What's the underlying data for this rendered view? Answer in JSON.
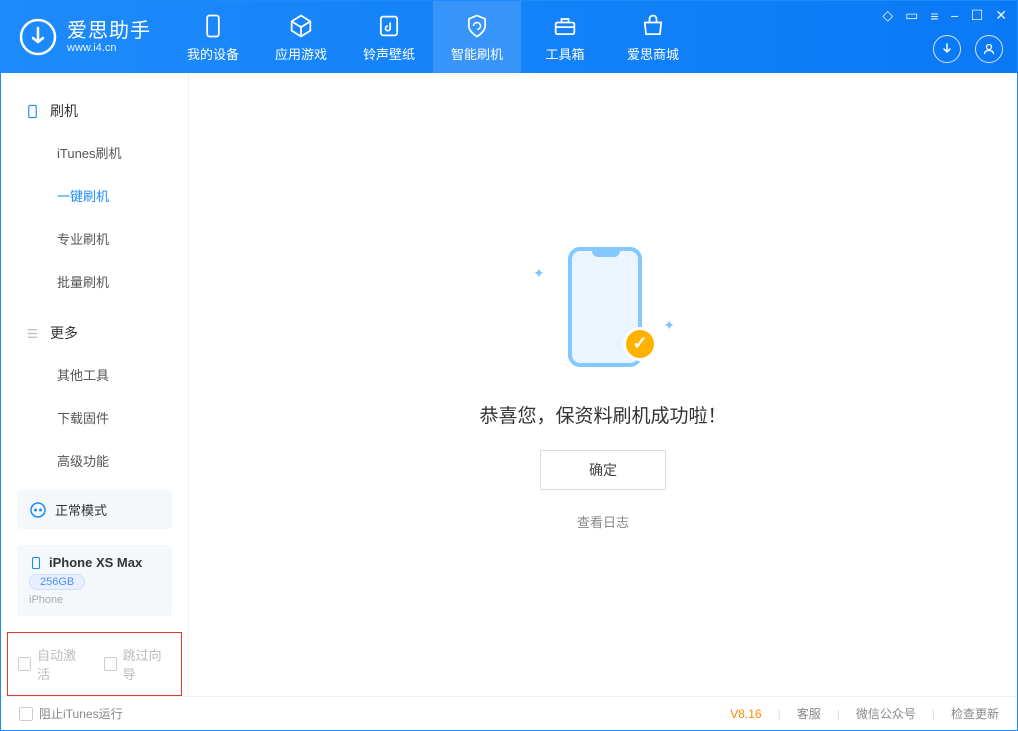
{
  "app": {
    "name": "爱思助手",
    "domain": "www.i4.cn"
  },
  "tabs": {
    "device": "我的设备",
    "apps": "应用游戏",
    "ringtones": "铃声壁纸",
    "flash": "智能刷机",
    "toolbox": "工具箱",
    "store": "爱思商城"
  },
  "sidebar": {
    "section_flash": "刷机",
    "items": {
      "itunes": "iTunes刷机",
      "oneclick": "一键刷机",
      "pro": "专业刷机",
      "batch": "批量刷机"
    },
    "section_more": "更多",
    "more_items": {
      "other": "其他工具",
      "firmware": "下载固件",
      "advanced": "高级功能"
    }
  },
  "mode": {
    "label": "正常模式"
  },
  "device": {
    "name": "iPhone XS Max",
    "capacity": "256GB",
    "type": "iPhone"
  },
  "options": {
    "auto_activate": "自动激活",
    "skip_guide": "跳过向导"
  },
  "main": {
    "message": "恭喜您，保资料刷机成功啦！",
    "ok": "确定",
    "view_log": "查看日志"
  },
  "status": {
    "block_itunes": "阻止iTunes运行",
    "version": "V8.16",
    "support": "客服",
    "wechat": "微信公众号",
    "check_update": "检查更新"
  },
  "icons": {
    "download": "↓",
    "user": "◯",
    "feedback_t": "◇",
    "feedback_s": "▭",
    "menu": "≡",
    "min": "−",
    "max": "☐",
    "close": "✕",
    "check": "✓",
    "sparkle": "✦"
  }
}
